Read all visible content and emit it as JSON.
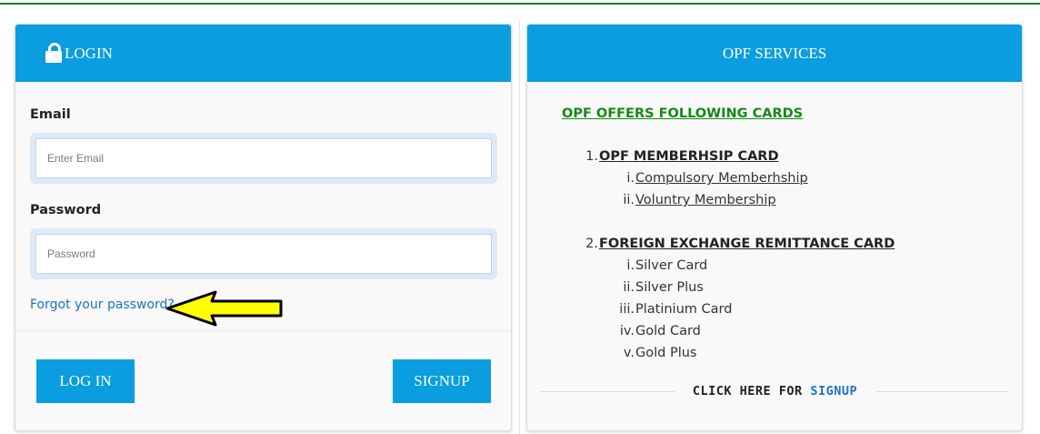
{
  "login": {
    "title": "LOGIN",
    "email_label": "Email",
    "email_placeholder": "Enter Email",
    "email_value": "",
    "password_label": "Password",
    "password_placeholder": "Password",
    "password_value": "",
    "forgot_link": "Forgot your password?",
    "login_button": "LOG IN",
    "signup_button": "SIGNUP",
    "annotation": {
      "type": "arrow",
      "color": "#ffff00"
    }
  },
  "services": {
    "title": "OPF SERVICES",
    "offers_title": "OPF OFFERS FOLLOWING CARDS",
    "cards": [
      {
        "marker": "1.",
        "name": "OPF MEMBERHSIP CARD",
        "items": [
          {
            "marker": "i.",
            "label": "Compulsory Memberhship"
          },
          {
            "marker": "ii.",
            "label": "Voluntry Membership"
          }
        ]
      },
      {
        "marker": "2.",
        "name": "FOREIGN EXCHANGE REMITTANCE CARD",
        "items": [
          {
            "marker": "i.",
            "label": "Silver Card"
          },
          {
            "marker": "ii.",
            "label": "Silver Plus"
          },
          {
            "marker": "iii.",
            "label": "Platinium Card"
          },
          {
            "marker": "iv.",
            "label": "Gold Card"
          },
          {
            "marker": "v.",
            "label": "Gold Plus"
          }
        ]
      }
    ],
    "signup_prefix": "CLICK HERE FOR",
    "signup_link": "SIGNUP"
  },
  "colors": {
    "header_blue": "#0a9de0",
    "top_border_green": "#1e7d2a",
    "offers_green": "#148a14",
    "link_blue": "#1a73c8"
  },
  "icons": [
    "lock-icon",
    "arrow-pointer-icon"
  ]
}
